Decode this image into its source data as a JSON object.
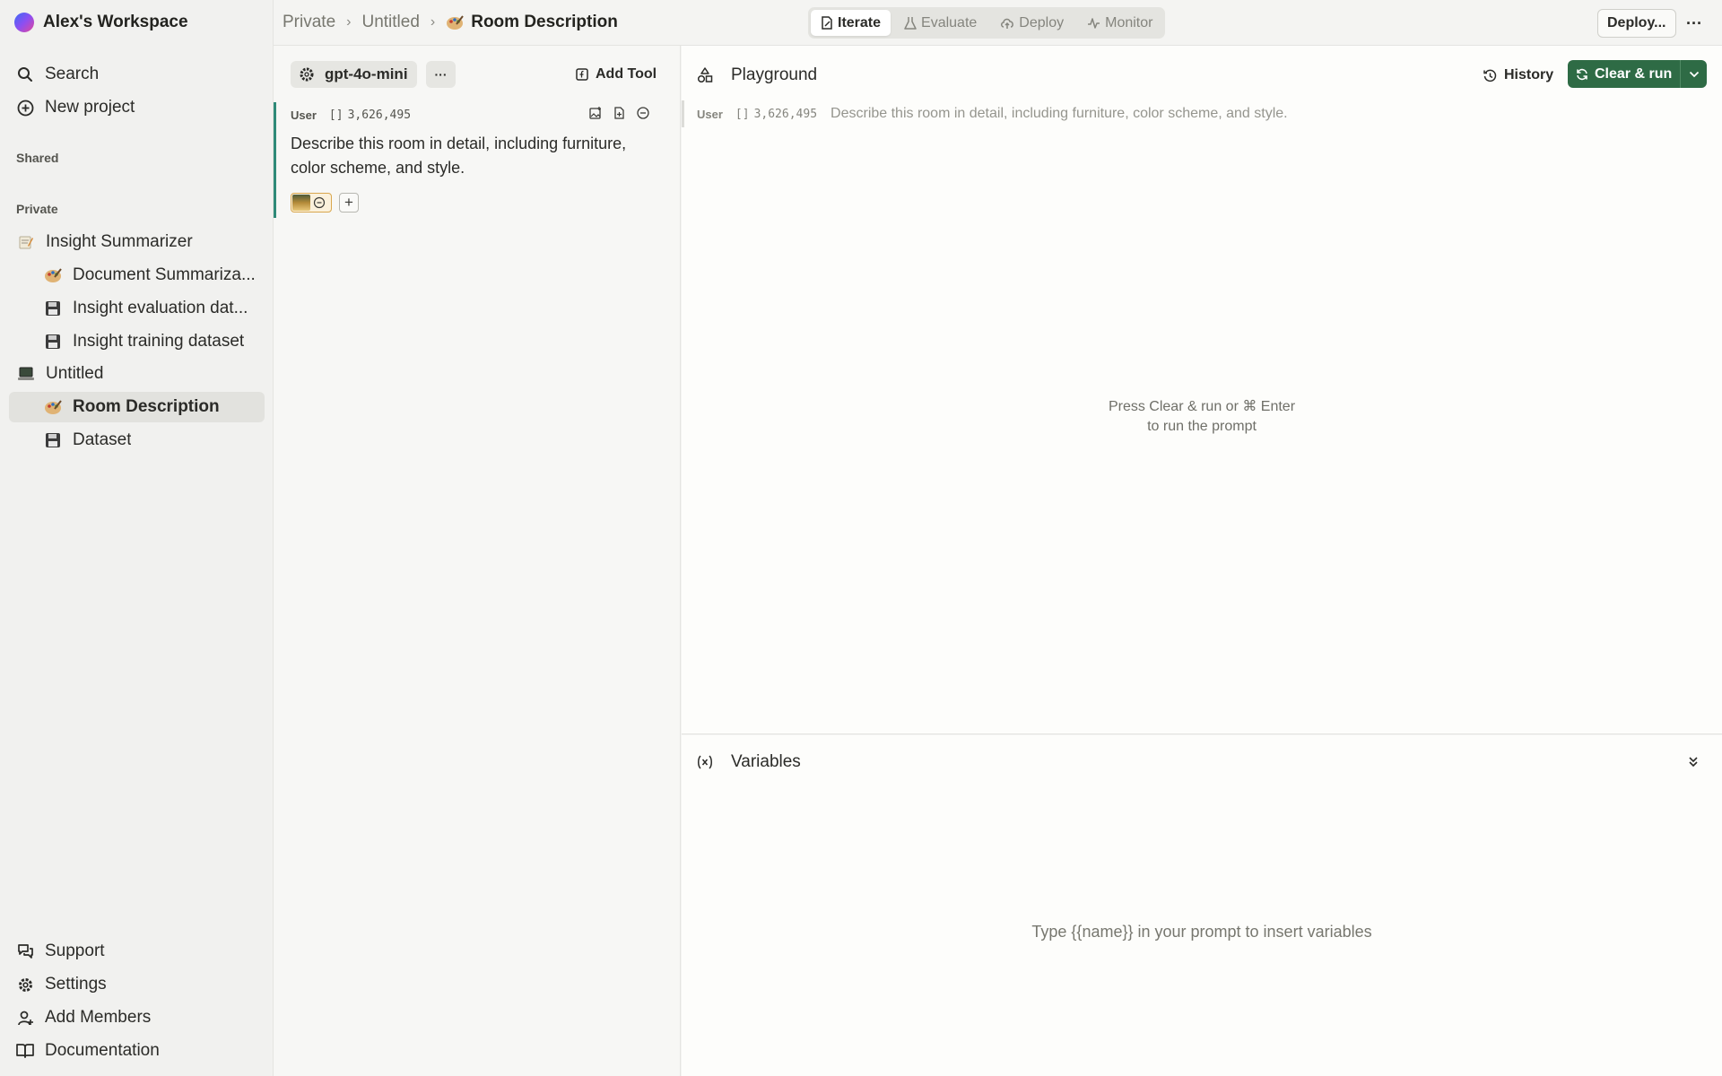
{
  "sidebar": {
    "workspace_name": "Alex's Workspace",
    "nav": [
      {
        "label": "Search",
        "icon": "search-icon"
      },
      {
        "label": "New project",
        "icon": "plus-circle-icon"
      }
    ],
    "shared_label": "Shared",
    "private_label": "Private",
    "tree": [
      {
        "label": "Insight Summarizer",
        "emoji": "memo-icon",
        "level": 1
      },
      {
        "label": "Document Summariza...",
        "emoji": "palette-icon",
        "level": 2
      },
      {
        "label": "Insight evaluation dat...",
        "emoji": "floppy-disk-icon",
        "level": 2
      },
      {
        "label": "Insight training dataset",
        "emoji": "floppy-disk-icon",
        "level": 2
      },
      {
        "label": "Untitled",
        "emoji": "laptop-icon",
        "level": 1
      },
      {
        "label": "Room Description",
        "emoji": "palette-icon",
        "level": 2,
        "active": true
      },
      {
        "label": "Dataset",
        "emoji": "floppy-disk-icon",
        "level": 2
      }
    ],
    "bottom_nav": [
      {
        "label": "Support",
        "icon": "chat-bubbles-icon"
      },
      {
        "label": "Settings",
        "icon": "gear-icon"
      },
      {
        "label": "Add Members",
        "icon": "user-plus-icon"
      },
      {
        "label": "Documentation",
        "icon": "book-icon"
      }
    ]
  },
  "topbar": {
    "breadcrumbs": [
      "Private",
      "Untitled",
      "Room Description"
    ],
    "modes": [
      {
        "label": "Iterate",
        "icon": "document-edit-icon",
        "active": true
      },
      {
        "label": "Evaluate",
        "icon": "flask-icon",
        "active": false
      },
      {
        "label": "Deploy",
        "icon": "cloud-upload-icon",
        "active": false
      },
      {
        "label": "Monitor",
        "icon": "pulse-icon",
        "active": false
      }
    ],
    "deploy_button": "Deploy...",
    "more_label": "···"
  },
  "editor": {
    "model": "gpt-4o-mini",
    "more_label": "···",
    "add_tool": "Add Tool",
    "message": {
      "role": "User",
      "token_count": "3,626,495",
      "text": "Describe this room in detail, including furniture, color scheme, and style."
    },
    "add_label": "+"
  },
  "playground": {
    "title": "Playground",
    "history": "History",
    "run_label": "Clear & run",
    "message": {
      "role": "User",
      "token_count": "3,626,495",
      "text": "Describe this room in detail, including furniture, color scheme, and style."
    },
    "empty_line1": "Press Clear & run or ⌘ Enter",
    "empty_line2": "to run the prompt"
  },
  "variables": {
    "title": "Variables",
    "empty": "Type {{name}} in your prompt to insert variables"
  },
  "colors": {
    "accent_green": "#2e6b45",
    "message_bar": "#2f8a78",
    "sidebar_bg": "#f1f1ef"
  }
}
